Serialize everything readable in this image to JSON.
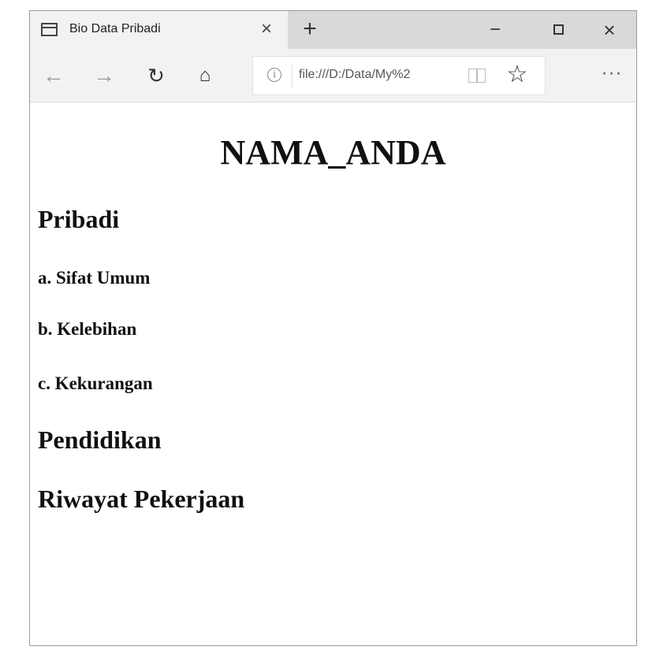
{
  "browser": {
    "tab": {
      "title": "Bio Data Pribadi",
      "close_symbol": "×"
    },
    "new_tab_symbol": "+",
    "window_controls": {
      "minimize_symbol": "−",
      "close_symbol": "×"
    },
    "nav": {
      "back_symbol": "←",
      "forward_symbol": "→",
      "refresh_symbol": "↻",
      "home_symbol": "⌂",
      "info_symbol": "i",
      "favorite_symbol": "☆",
      "more_symbol": "···"
    },
    "address": {
      "url": "file:///D:/Data/My%2"
    },
    "icons": {
      "tab": "tab-icon",
      "back": "back-arrow-icon",
      "forward": "forward-arrow-icon",
      "refresh": "refresh-icon",
      "home": "home-icon",
      "info": "info-icon",
      "reading_view": "reading-view-icon",
      "favorite": "star-icon",
      "more": "more-icon"
    }
  },
  "page": {
    "title": "NAMA_ANDA",
    "sections": {
      "pribadi": "Pribadi",
      "sifat_umum": "a. Sifat Umum",
      "kelebihan": "b. Kelebihan",
      "kekurangan": "c. Kekurangan",
      "pendidikan": "Pendidikan",
      "riwayat_pekerjaan": "Riwayat Pekerjaan"
    }
  }
}
